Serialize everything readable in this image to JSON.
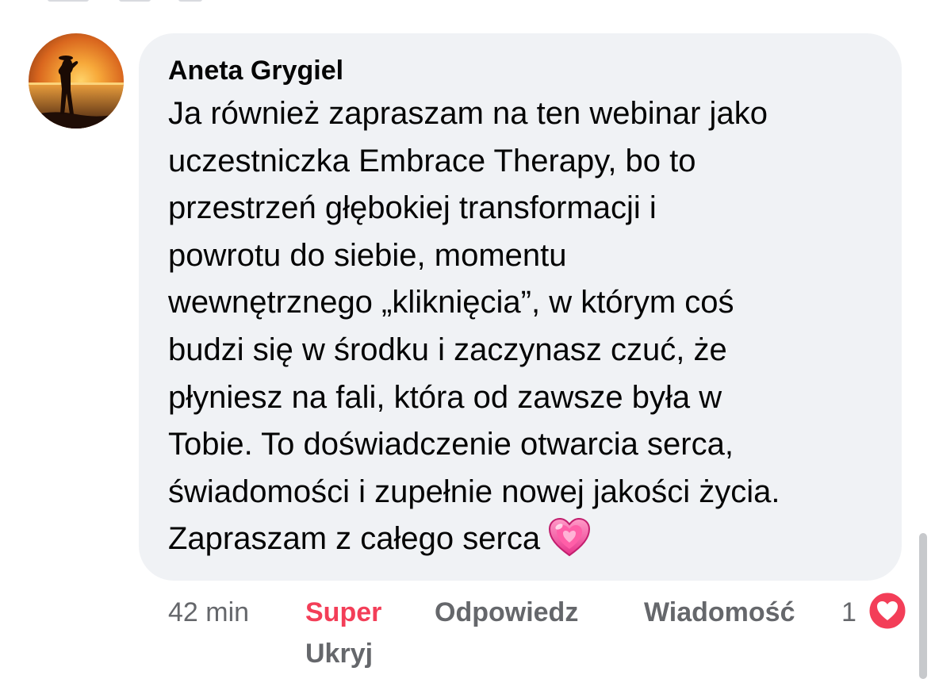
{
  "comment": {
    "author": "Aneta Grygiel",
    "text_lines": [
      "Ja również zapraszam na ten webinar jako",
      "uczestniczka Embrace Therapy, bo to",
      "przestrzeń głębokiej transformacji i",
      "powrotu do siebie, momentu",
      "wewnętrznego „kliknięcia”, w którym coś",
      "budzi się w środku i zaczynasz czuć, że",
      "płyniesz na fali, która od zawsze była w",
      "Tobie. To doświadczenie otwarcia serca,",
      "świadomości i zupełnie nowej jakości życia.",
      "Zapraszam z całego serca"
    ],
    "emoji": "sparkling-heart"
  },
  "actions": {
    "time": "42 min",
    "reaction_label": "Super",
    "reply_label": "Odpowiedz",
    "message_label": "Wiadomość",
    "hide_label": "Ukryj"
  },
  "reactions": {
    "count": "1",
    "icon": "heart-icon"
  },
  "colors": {
    "bubble": "#f0f2f5",
    "reaction_accent": "#f33e58",
    "secondary_text": "#65676b"
  }
}
